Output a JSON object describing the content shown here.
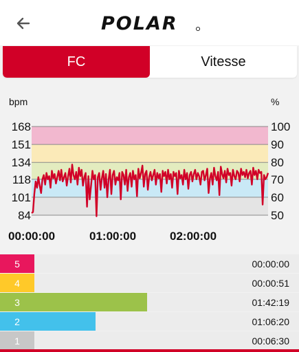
{
  "header": {
    "brand": "POLAR",
    "back_icon": "arrow-left-icon"
  },
  "tabs": [
    {
      "label": "FC",
      "active": true
    },
    {
      "label": "Vitesse",
      "active": false
    }
  ],
  "colors": {
    "accent": "#d10027",
    "zone5": "#e8175d",
    "zone4": "#ffc929",
    "zone3": "#9cc24a",
    "zone2": "#43c1eb",
    "zone1": "#c7c7c7",
    "band5": "#f2b8cf",
    "band4": "#fbeab8",
    "band3": "#e3ecbf",
    "band2": "#c9e9f6",
    "band1": "#e4e4e4",
    "line": "#d10027"
  },
  "chart_data": {
    "type": "line",
    "xlabel": "",
    "ylabel": "bpm",
    "y2label": "%",
    "x_ticks": [
      "00:00:00",
      "01:00:00",
      "02:00:00"
    ],
    "y_ticks": [
      84,
      101,
      118,
      134,
      151,
      168
    ],
    "y2_ticks": [
      50,
      60,
      70,
      80,
      90,
      100
    ],
    "ylim": [
      84,
      168
    ],
    "x_range_minutes": [
      0,
      175
    ],
    "zone_bands": [
      {
        "zone": 5,
        "from": 151,
        "to": 168
      },
      {
        "zone": 4,
        "from": 134,
        "to": 151
      },
      {
        "zone": 3,
        "from": 118,
        "to": 134
      },
      {
        "zone": 2,
        "from": 101,
        "to": 118
      },
      {
        "zone": 1,
        "from": 84,
        "to": 101
      }
    ],
    "series": [
      {
        "x": [
          0,
          1,
          2,
          3,
          4,
          5,
          6,
          7,
          8,
          9,
          10,
          11,
          12,
          13,
          14,
          15,
          16,
          17,
          18,
          19,
          20,
          21,
          22,
          23,
          24,
          25,
          26,
          27,
          28,
          29,
          30,
          31,
          32,
          33,
          34,
          35,
          36,
          37,
          38,
          39,
          40,
          41,
          42,
          43,
          44,
          45,
          46,
          47,
          48,
          49,
          50,
          51,
          52,
          53,
          54,
          55,
          56,
          57,
          58,
          59,
          60,
          61,
          62,
          63,
          64,
          65,
          66,
          67,
          68,
          69,
          70,
          71,
          72,
          73,
          74,
          75,
          76,
          77,
          78,
          79,
          80,
          81,
          82,
          83,
          84,
          85,
          86,
          87,
          88,
          89,
          90,
          91,
          92,
          93,
          94,
          95,
          96,
          97,
          98,
          99,
          100,
          101,
          102,
          103,
          104,
          105,
          106,
          107,
          108,
          109,
          110,
          111,
          112,
          113,
          114,
          115,
          116,
          117,
          118,
          119,
          120,
          121,
          122,
          123,
          124,
          125,
          126,
          127,
          128,
          129,
          130,
          131,
          132,
          133,
          134,
          135,
          136,
          137,
          138,
          139,
          140,
          141,
          142,
          143,
          144,
          145,
          146,
          147,
          148,
          149,
          150,
          151,
          152,
          153,
          154,
          155,
          156,
          157,
          158,
          159,
          160,
          161,
          162,
          163,
          164,
          165,
          166,
          167,
          168,
          169,
          170,
          171,
          172,
          173,
          174,
          175
        ],
        "y": [
          86,
          87,
          104,
          116,
          110,
          120,
          112,
          105,
          118,
          122,
          113,
          124,
          118,
          121,
          110,
          126,
          119,
          123,
          114,
          120,
          126,
          117,
          127,
          116,
          120,
          124,
          112,
          121,
          128,
          115,
          132,
          122,
          118,
          125,
          113,
          129,
          121,
          127,
          112,
          120,
          124,
          92,
          121,
          99,
          112,
          126,
          118,
          122,
          83,
          120,
          124,
          108,
          119,
          126,
          110,
          123,
          101,
          118,
          127,
          104,
          122,
          126,
          113,
          120,
          117,
          124,
          99,
          125,
          122,
          113,
          127,
          107,
          120,
          124,
          111,
          126,
          118,
          122,
          102,
          128,
          119,
          124,
          131,
          111,
          123,
          126,
          108,
          120,
          125,
          117,
          122,
          127,
          113,
          124,
          119,
          123,
          106,
          126,
          121,
          125,
          114,
          127,
          118,
          123,
          110,
          125,
          121,
          124,
          104,
          126,
          119,
          122,
          113,
          127,
          118,
          124,
          109,
          122,
          125,
          116,
          123,
          127,
          118,
          124,
          121,
          113,
          125,
          126,
          117,
          122,
          128,
          105,
          119,
          124,
          113,
          129,
          121,
          117,
          125,
          103,
          130,
          123,
          119,
          126,
          115,
          128,
          122,
          124,
          112,
          127,
          121,
          118,
          126,
          124,
          116,
          128,
          122,
          125,
          120,
          127,
          119,
          124,
          126,
          113,
          129,
          122,
          126,
          118,
          127,
          124,
          125,
          94,
          122,
          118,
          120,
          124
        ]
      }
    ]
  },
  "zones": [
    {
      "num": "5",
      "time": "00:00:00",
      "fraction": 0.0
    },
    {
      "num": "4",
      "time": "00:00:51",
      "fraction": 0.003
    },
    {
      "num": "3",
      "time": "01:42:19",
      "fraction": 0.493
    },
    {
      "num": "2",
      "time": "01:06:20",
      "fraction": 0.32
    },
    {
      "num": "1",
      "time": "00:06:30",
      "fraction": 0.031
    }
  ]
}
